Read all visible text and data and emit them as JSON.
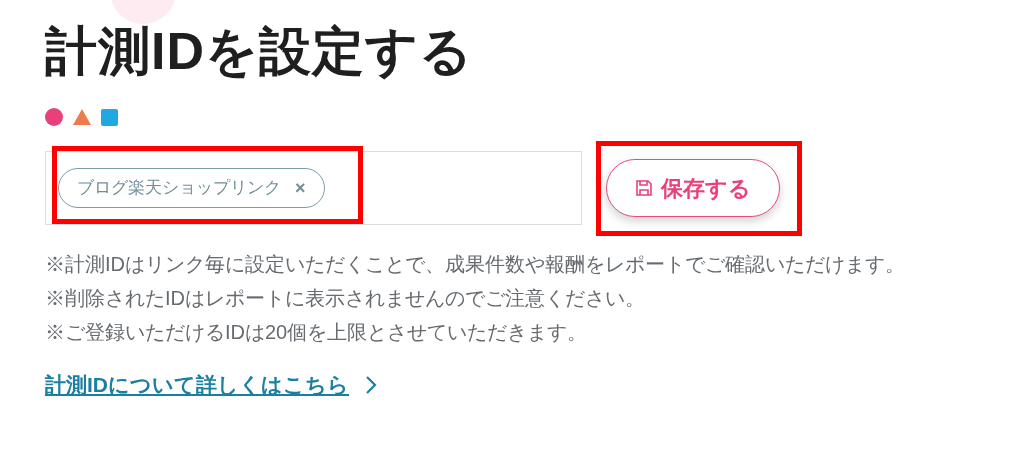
{
  "title": "計測IDを設定する",
  "tag_input": {
    "highlighted": true,
    "tags": [
      {
        "label": "ブログ楽天ショップリンク",
        "remove": "×"
      }
    ]
  },
  "save_button": {
    "label": "保存する",
    "highlighted": true
  },
  "notes": [
    "※計測IDはリンク毎に設定いただくことで、成果件数や報酬をレポートでご確認いただけます。",
    "※削除されたIDはレポートに表示されませんのでご注意ください。",
    "※ご登録いただけるIDは20個を上限とさせていただきます。"
  ],
  "link": {
    "label": "計測IDについて詳しくはこちら"
  }
}
